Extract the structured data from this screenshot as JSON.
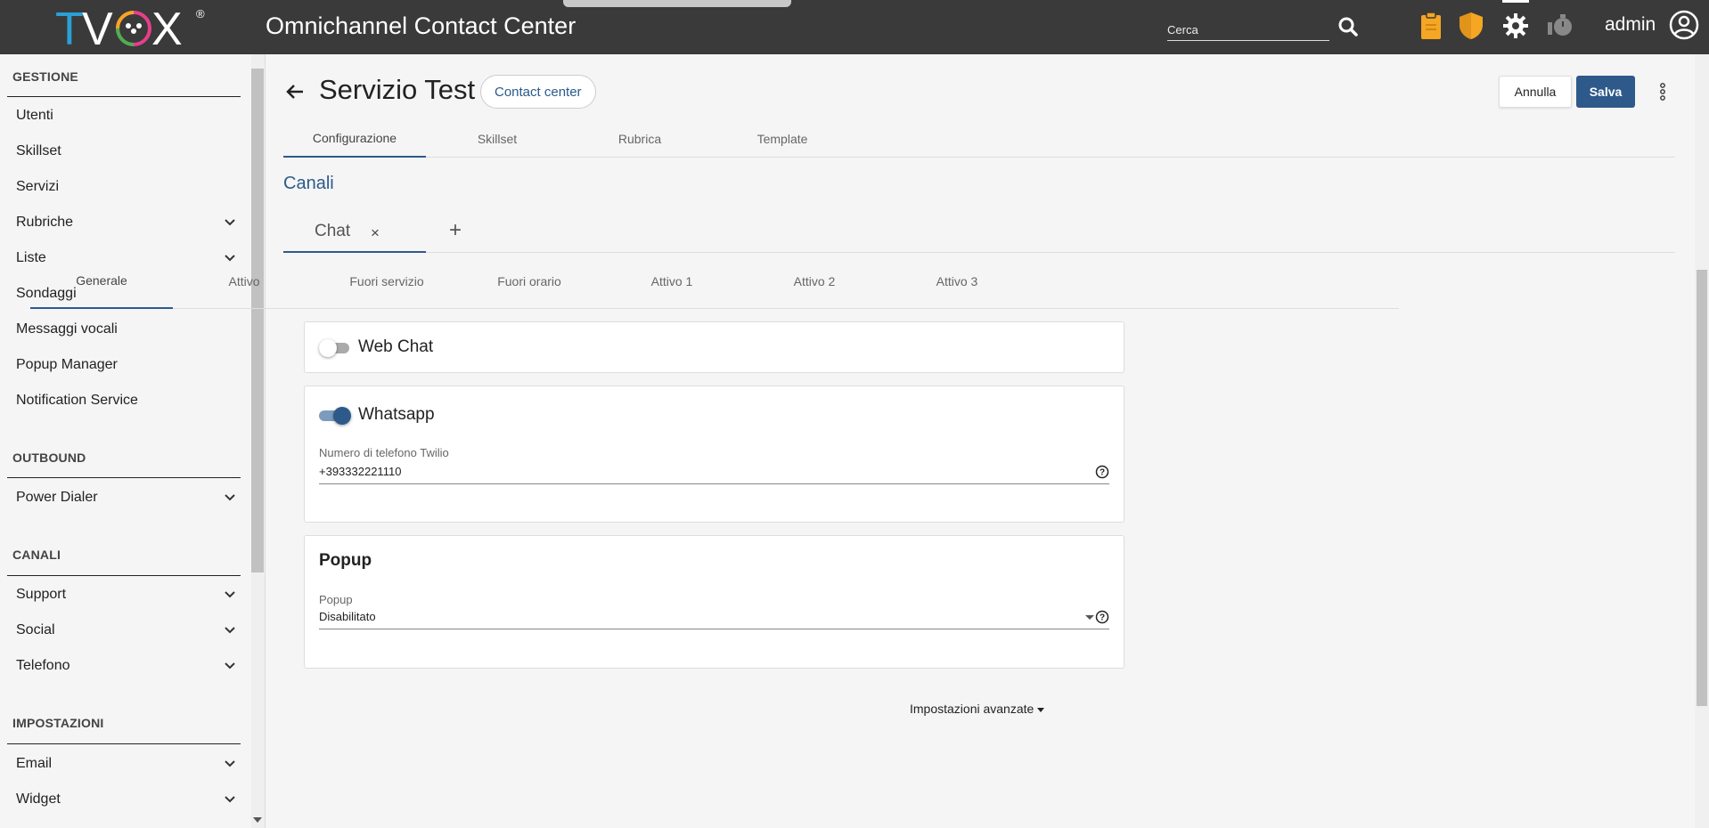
{
  "topbar": {
    "logo_text": "TVŌX",
    "logo_registered": "®",
    "app_title": "Omnichannel Contact Center",
    "search_placeholder": "Cerca",
    "username": "admin",
    "icons": [
      "clipboard-icon",
      "shield-icon",
      "gear-icon",
      "timer-icon",
      "user-circle-icon"
    ],
    "colors": {
      "background": "#3a3a3a",
      "clipboard": "#f5a623",
      "shield": "#f5a623"
    }
  },
  "sidebar": {
    "sections": [
      {
        "title": "GESTIONE",
        "items": [
          {
            "label": "Utenti",
            "expandable": false
          },
          {
            "label": "Skillset",
            "expandable": false
          },
          {
            "label": "Servizi",
            "expandable": false
          },
          {
            "label": "Rubriche",
            "expandable": true
          },
          {
            "label": "Liste",
            "expandable": true
          },
          {
            "label": "Sondaggi",
            "expandable": false
          },
          {
            "label": "Messaggi vocali",
            "expandable": false
          },
          {
            "label": "Popup Manager",
            "expandable": false
          },
          {
            "label": "Notification Service",
            "expandable": false
          }
        ]
      },
      {
        "title": "OUTBOUND",
        "items": [
          {
            "label": "Power Dialer",
            "expandable": true
          }
        ]
      },
      {
        "title": "CANALI",
        "items": [
          {
            "label": "Support",
            "expandable": true
          },
          {
            "label": "Social",
            "expandable": true
          },
          {
            "label": "Telefono",
            "expandable": true
          }
        ]
      },
      {
        "title": "IMPOSTAZIONI",
        "items": [
          {
            "label": "Email",
            "expandable": true
          },
          {
            "label": "Widget",
            "expandable": true
          }
        ]
      }
    ]
  },
  "header": {
    "title": "Servizio Test",
    "chip": "Contact center",
    "cancel_label": "Annulla",
    "save_label": "Salva"
  },
  "main_tabs": [
    {
      "label": "Configurazione",
      "active": true
    },
    {
      "label": "Skillset",
      "active": false
    },
    {
      "label": "Rubrica",
      "active": false
    },
    {
      "label": "Template",
      "active": false
    }
  ],
  "channels": {
    "title": "Canali",
    "tab_label": "Chat",
    "close_symbol": "×",
    "add_symbol": "+"
  },
  "sub_tabs": [
    {
      "label": "Generale",
      "active": true
    },
    {
      "label": "Attivo",
      "active": false
    },
    {
      "label": "Fuori servizio",
      "active": false
    },
    {
      "label": "Fuori orario",
      "active": false
    },
    {
      "label": "Attivo 1",
      "active": false
    },
    {
      "label": "Attivo 2",
      "active": false
    },
    {
      "label": "Attivo 3",
      "active": false
    }
  ],
  "cards": {
    "webchat": {
      "title": "Web Chat",
      "enabled": false
    },
    "whatsapp": {
      "title": "Whatsapp",
      "enabled": true,
      "field_label": "Numero di telefono Twilio",
      "field_value": "+393332221110"
    },
    "popup": {
      "title": "Popup",
      "field_label": "Popup",
      "field_value": "Disabilitato"
    }
  },
  "advanced_label": "Impostazioni avanzate",
  "colors": {
    "accent": "#2d5a8a",
    "toggle_on_track": "#7d9cbd"
  }
}
